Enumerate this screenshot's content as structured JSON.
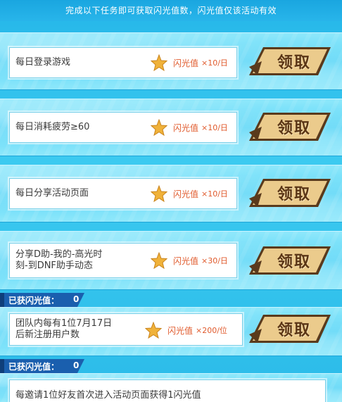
{
  "top_note": "完成以下任务即可获取闪光值数，闪光值仅该活动有效",
  "reward_name": "闪光值",
  "claim_label": "领取",
  "tasks": [
    {
      "label_line1": "每日登录游戏",
      "label_line2": "",
      "multiplier": "×10/日"
    },
    {
      "label_line1": "每日消耗疲劳≥60",
      "label_line2": "",
      "multiplier": "×10/日"
    },
    {
      "label_line1": "每日分享活动页面",
      "label_line2": "",
      "multiplier": "×10/日"
    },
    {
      "label_line1": "分享D助-我的-高光时",
      "label_line2": "刻-到DNF助手动态",
      "multiplier": "×30/日"
    },
    {
      "label_line1": "团队内每有1位7月17日",
      "label_line2": "后新注册用户数",
      "multiplier": "×200/位"
    }
  ],
  "flash_status": [
    {
      "label": "已获闪光值：",
      "value": "0"
    },
    {
      "label": "已获闪光值：",
      "value": "0"
    }
  ],
  "invite_task": "每邀请1位好友首次进入活动页面获得1闪光值",
  "colors": {
    "accent_orange": "#e05a2c",
    "button_gold": "#e9c88a",
    "banner_blue": "#1a73c9"
  },
  "icons": {
    "reward": "star-icon"
  }
}
